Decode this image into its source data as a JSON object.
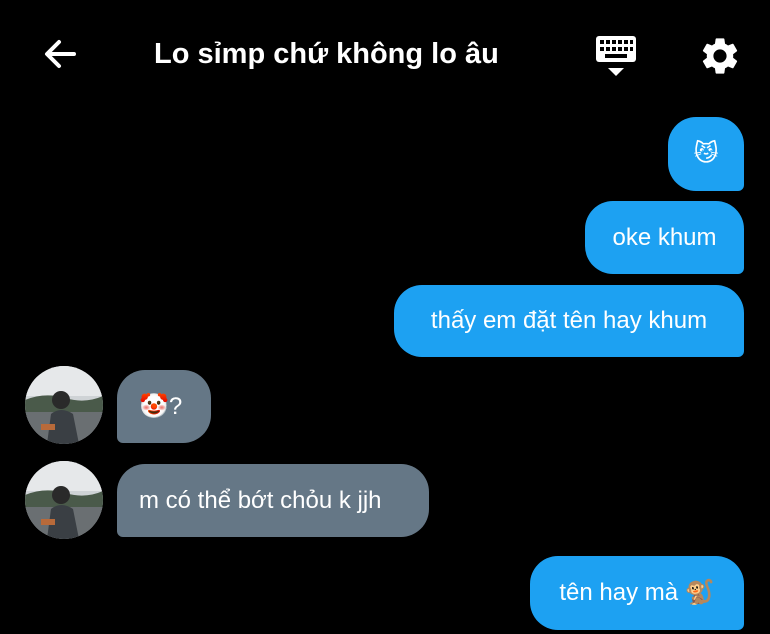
{
  "header": {
    "title": "Lo sỉmp chứ không lo âu",
    "back_icon": "arrow-left-icon",
    "keyboard_icon": "keyboard-icon",
    "settings_icon": "gear-icon"
  },
  "colors": {
    "background": "#000000",
    "outgoing_bubble": "#1da1f2",
    "incoming_bubble": "#657786",
    "text": "#ffffff"
  },
  "messages": [
    {
      "direction": "outgoing",
      "text": "😼"
    },
    {
      "direction": "outgoing",
      "text": "oke khum"
    },
    {
      "direction": "outgoing",
      "text": "thấy em đặt tên hay khum"
    },
    {
      "direction": "incoming",
      "text": "🤡?"
    },
    {
      "direction": "incoming",
      "text": "m có thể bớt chỏu k jjh"
    },
    {
      "direction": "outgoing",
      "text": "tên hay mà 🐒"
    }
  ]
}
